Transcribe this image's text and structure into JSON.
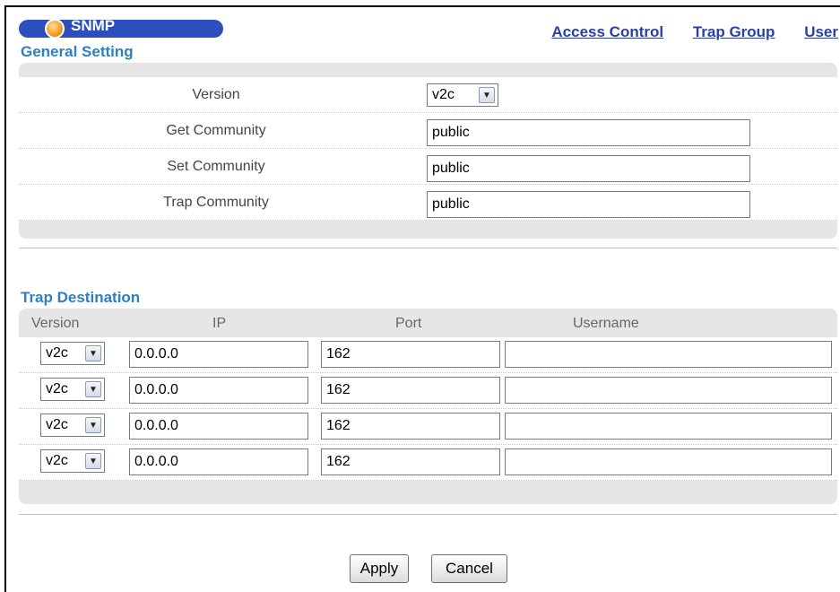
{
  "header": {
    "title": "SNMP",
    "links": [
      "Access Control",
      "Trap Group",
      "User"
    ]
  },
  "general_setting": {
    "title": "General Setting",
    "rows": [
      {
        "label": "Version",
        "type": "select",
        "value": "v2c"
      },
      {
        "label": "Get Community",
        "type": "text",
        "value": "public"
      },
      {
        "label": "Set Community",
        "type": "text",
        "value": "public"
      },
      {
        "label": "Trap Community",
        "type": "text",
        "value": "public"
      }
    ]
  },
  "trap_destination": {
    "title": "Trap Destination",
    "columns": [
      "Version",
      "IP",
      "Port",
      "Username"
    ],
    "rows": [
      {
        "version": "v2c",
        "ip": "0.0.0.0",
        "port": "162",
        "username": ""
      },
      {
        "version": "v2c",
        "ip": "0.0.0.0",
        "port": "162",
        "username": ""
      },
      {
        "version": "v2c",
        "ip": "0.0.0.0",
        "port": "162",
        "username": ""
      },
      {
        "version": "v2c",
        "ip": "0.0.0.0",
        "port": "162",
        "username": ""
      }
    ]
  },
  "buttons": {
    "apply": "Apply",
    "cancel": "Cancel"
  },
  "colors": {
    "accent": "#2f7fbf",
    "link": "#2c3fa6",
    "pill": "#2d4fbd",
    "panel": "#e6e6e6"
  }
}
